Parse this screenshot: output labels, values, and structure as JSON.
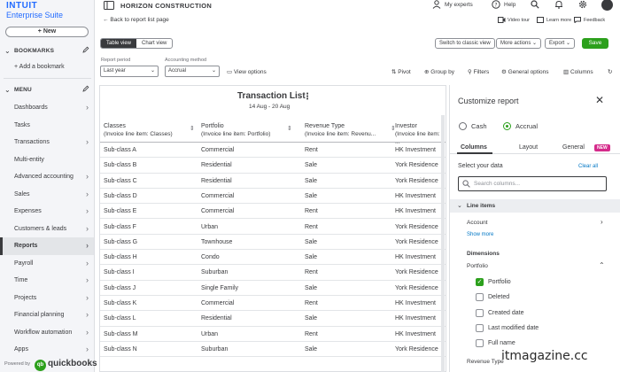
{
  "brand": {
    "line1": "INTUIT",
    "line2": "Enterprise Suite"
  },
  "company_name": "HORIZON CONSTRUCTION",
  "header": {
    "my_experts": "My experts",
    "help": "Help",
    "video_tour": "Video tour",
    "learn_more": "Learn more",
    "feedback": "Feedback"
  },
  "sidebar": {
    "new_label": "+ New",
    "bookmarks_header": "BOOKMARKS",
    "add_bookmark": "+ Add a bookmark",
    "menu_header": "MENU",
    "items": [
      {
        "label": "Dashboards"
      },
      {
        "label": "Tasks"
      },
      {
        "label": "Transactions"
      },
      {
        "label": "Multi-entity"
      },
      {
        "label": "Advanced accounting"
      },
      {
        "label": "Sales"
      },
      {
        "label": "Expenses"
      },
      {
        "label": "Customers & leads"
      },
      {
        "label": "Reports"
      },
      {
        "label": "Payroll"
      },
      {
        "label": "Time"
      },
      {
        "label": "Projects"
      },
      {
        "label": "Financial planning"
      },
      {
        "label": "Workflow automation"
      },
      {
        "label": "Apps"
      }
    ],
    "powered_by": "Powered by",
    "qb_glyph": "qb",
    "qb_name": "quickbooks"
  },
  "toolbar": {
    "back_link": "Back to report list page",
    "table_view": "Table view",
    "chart_view": "Chart view",
    "switch_classic": "Switch to classic view",
    "more_actions": "More actions",
    "export": "Export",
    "save": "Save",
    "report_period_label": "Report period",
    "report_period_value": "Last year",
    "accounting_method_label": "Accounting method",
    "accounting_method_value": "Accrual",
    "view_options": "View options",
    "pivot": "Pivot",
    "group_by": "Group by",
    "filters": "Filters",
    "general_options": "General options",
    "columns": "Columns"
  },
  "report": {
    "title": "Transaction List",
    "date_range": "14 Aug - 20 Aug",
    "columns": [
      {
        "label": "Classes",
        "sub": "(Invoice line item: Classes)"
      },
      {
        "label": "Portfolio",
        "sub": "(Invoice line item: Portfolio)"
      },
      {
        "label": "Revenue Type",
        "sub": "(Invoice line item: Revenu..."
      },
      {
        "label": "Investor",
        "sub": "(Invoice line item: ..."
      }
    ],
    "rows": [
      {
        "c": "Sub-class A",
        "p": "Commercial",
        "r": "Rent",
        "i": "HK Investment"
      },
      {
        "c": "Sub-class B",
        "p": "Residential",
        "r": "Sale",
        "i": "York Residence"
      },
      {
        "c": "Sub-class C",
        "p": "Residential",
        "r": "Sale",
        "i": "York Residence"
      },
      {
        "c": "Sub-class D",
        "p": "Commercial",
        "r": "Sale",
        "i": "HK Investment"
      },
      {
        "c": "Sub-class E",
        "p": "Commercial",
        "r": "Rent",
        "i": "HK Investment"
      },
      {
        "c": "Sub-class F",
        "p": "Urban",
        "r": "Rent",
        "i": "York Residence"
      },
      {
        "c": "Sub-class G",
        "p": "Townhouse",
        "r": "Sale",
        "i": "York Residence"
      },
      {
        "c": "Sub-class H",
        "p": "Condo",
        "r": "Sale",
        "i": "HK Investment"
      },
      {
        "c": "Sub-class I",
        "p": "Suburban",
        "r": "Rent",
        "i": "York Residence"
      },
      {
        "c": "Sub-class J",
        "p": "Single Family",
        "r": "Sale",
        "i": "York Residence"
      },
      {
        "c": "Sub-class K",
        "p": "Commercial",
        "r": "Rent",
        "i": "HK Investment"
      },
      {
        "c": "Sub-class L",
        "p": "Residential",
        "r": "Sale",
        "i": "HK Investment"
      },
      {
        "c": "Sub-class M",
        "p": "Urban",
        "r": "Rent",
        "i": "HK Investment"
      },
      {
        "c": "Sub-class N",
        "p": "Suburban",
        "r": "Sale",
        "i": "York Residence"
      }
    ]
  },
  "panel": {
    "title": "Customize report",
    "cash": "Cash",
    "accrual": "Accrual",
    "tabs": [
      "Columns",
      "Layout",
      "General"
    ],
    "new_badge": "NEW",
    "select_data": "Select your data",
    "clear_all": "Clear all",
    "search_placeholder": "Search columns...",
    "line_items": "Line items",
    "account": "Account",
    "show_more": "Show more",
    "dimensions": "Dimensions",
    "portfolio_group": "Portfolio",
    "checkboxes": [
      {
        "label": "Portfolio",
        "checked": true
      },
      {
        "label": "Deleted",
        "checked": false
      },
      {
        "label": "Created date",
        "checked": false
      },
      {
        "label": "Last modified date",
        "checked": false
      },
      {
        "label": "Full name",
        "checked": false
      }
    ],
    "revenue_type": "Revenue Type"
  },
  "watermark": "itmagazine.cc",
  "colors": {
    "brand_blue": "#236cff",
    "qb_green": "#2ca01c",
    "text": "#393a3d"
  }
}
